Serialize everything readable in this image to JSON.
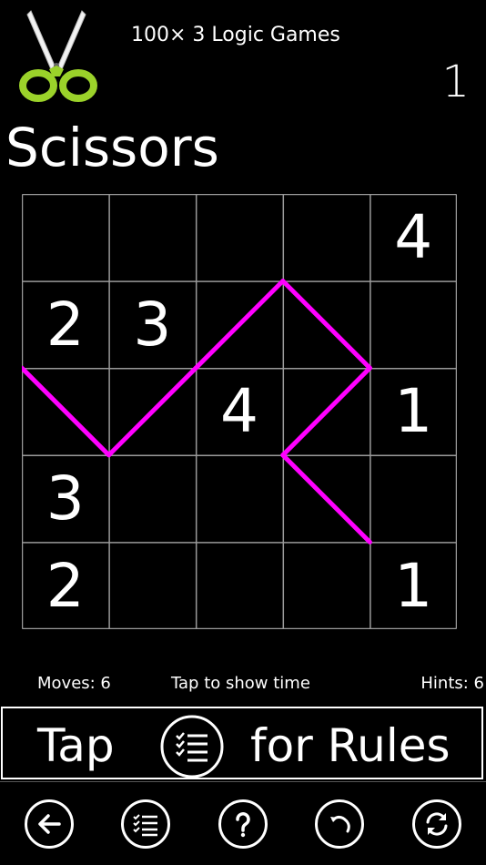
{
  "header": {
    "app_title": "100× 3 Logic Games",
    "level_number": "1",
    "game_title": "Scissors",
    "logo_icon": "scissors-logo-icon"
  },
  "board": {
    "rows": 5,
    "cols": 5,
    "grid_color": "#9a9a9a",
    "line_color": "#ff00ff",
    "cells": [
      [
        "",
        "",
        "",
        "",
        "4"
      ],
      [
        "2",
        "3",
        "",
        "",
        ""
      ],
      [
        "",
        "",
        "4",
        "",
        "1"
      ],
      [
        "3",
        "",
        "",
        "",
        ""
      ],
      [
        "2",
        "",
        "",
        "",
        "1"
      ]
    ],
    "segments": [
      [
        [
          0,
          2
        ],
        [
          1,
          3
        ]
      ],
      [
        [
          1,
          3
        ],
        [
          2,
          2
        ]
      ],
      [
        [
          2,
          2
        ],
        [
          3,
          1
        ]
      ],
      [
        [
          3,
          1
        ],
        [
          4,
          2
        ]
      ],
      [
        [
          4,
          2
        ],
        [
          3,
          3
        ]
      ],
      [
        [
          3,
          3
        ],
        [
          4,
          4
        ]
      ]
    ]
  },
  "status": {
    "moves": "Moves: 6",
    "timer": "Tap to show time",
    "hints": "Hints: 6"
  },
  "rules_bar": {
    "tap": "Tap",
    "for_rules": "for Rules",
    "icon": "rules-list-icon"
  },
  "toolbar": {
    "buttons": [
      "back-arrow-icon",
      "list-icon",
      "help-icon",
      "undo-icon",
      "refresh-icon"
    ]
  }
}
